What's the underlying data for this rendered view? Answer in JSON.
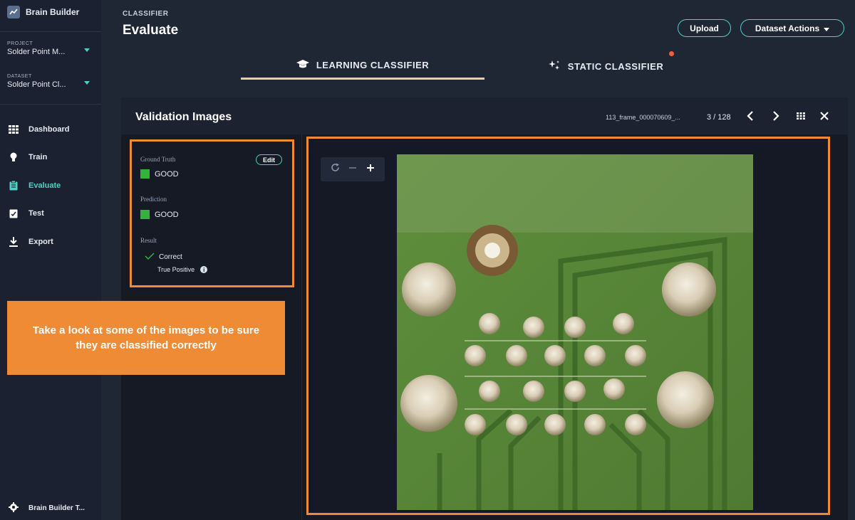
{
  "app": {
    "name": "Brain Builder"
  },
  "sidebar": {
    "project": {
      "caption": "PROJECT",
      "value": "Solder Point M..."
    },
    "dataset": {
      "caption": "DATASET",
      "value": "Solder Point Cl..."
    },
    "nav": [
      {
        "label": "Dashboard",
        "icon": "grid-icon"
      },
      {
        "label": "Train",
        "icon": "lightbulb-icon"
      },
      {
        "label": "Evaluate",
        "icon": "clipboard-icon",
        "active": true
      },
      {
        "label": "Test",
        "icon": "clipboard-check-icon"
      },
      {
        "label": "Export",
        "icon": "download-icon"
      }
    ],
    "footer_label": "Brain Builder T..."
  },
  "header": {
    "caption": "CLASSIFIER",
    "title": "Evaluate",
    "upload_label": "Upload",
    "dataset_actions_label": "Dataset Actions",
    "tabs": [
      {
        "label": "LEARNING CLASSIFIER",
        "icon": "graduation-cap-icon",
        "active": true
      },
      {
        "label": "STATIC CLASSIFIER",
        "icon": "sparkle-icon",
        "notification": true
      }
    ]
  },
  "panel": {
    "title": "Validation Images",
    "file_name": "113_frame_000070609_...",
    "counter": "3 / 128",
    "ground_truth": {
      "caption": "Ground Truth",
      "value": "GOOD",
      "edit_label": "Edit"
    },
    "prediction": {
      "caption": "Prediction",
      "value": "GOOD"
    },
    "result": {
      "caption": "Result",
      "value": "Correct",
      "detail": "True Positive"
    }
  },
  "callout": {
    "text": "Take a look at some of the images to be sure they are classified correctly"
  },
  "colors": {
    "accent": "#4fd1c5",
    "highlight": "#ef8a35",
    "good": "#34b33a",
    "notification": "#ff5b3a",
    "tab_underline": "#e8d38a"
  }
}
